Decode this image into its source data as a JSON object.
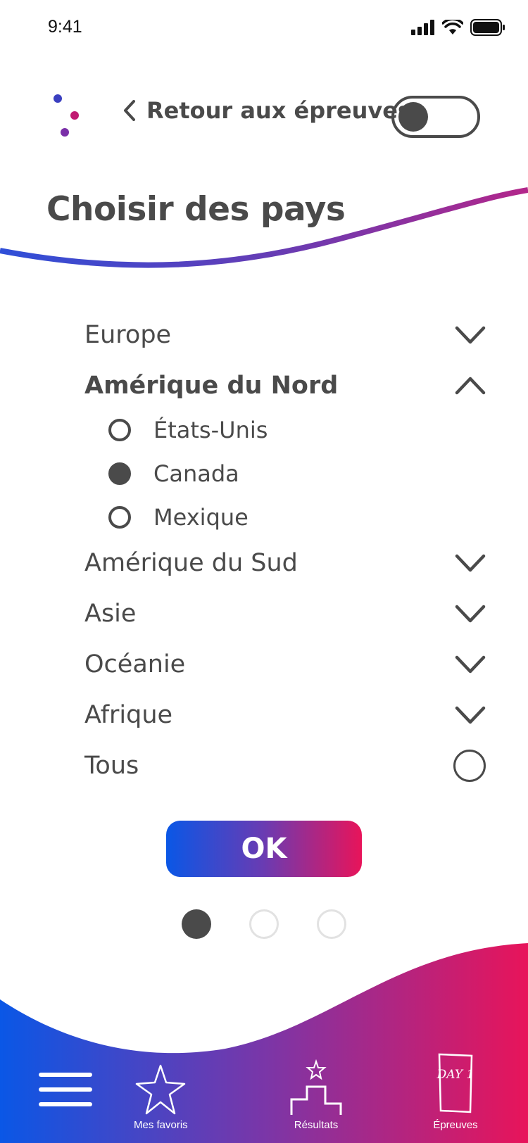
{
  "status_bar": {
    "time": "9:41"
  },
  "header": {
    "back_label": "Retour aux épreuves",
    "title": "Choisir des pays"
  },
  "regions": [
    {
      "label": "Europe",
      "expanded": false
    },
    {
      "label": "Amérique du Nord",
      "expanded": true,
      "countries": [
        {
          "label": "États-Unis",
          "selected": false
        },
        {
          "label": "Canada",
          "selected": true
        },
        {
          "label": "Mexique",
          "selected": false
        }
      ]
    },
    {
      "label": "Amérique du Sud",
      "expanded": false
    },
    {
      "label": "Asie",
      "expanded": false
    },
    {
      "label": "Océanie",
      "expanded": false
    },
    {
      "label": "Afrique",
      "expanded": false
    }
  ],
  "all_option": {
    "label": "Tous",
    "selected": false
  },
  "ok_button": {
    "label": "OK"
  },
  "pagination": {
    "current": 1,
    "total": 3
  },
  "bottom_nav": {
    "favorites_label": "Mes favoris",
    "results_label": "Résultats",
    "events_label": "Épreuves",
    "events_icon_text": "DAY 1"
  },
  "colors": {
    "text": "#4a4a4a",
    "gradient_start": "#0a57e6",
    "gradient_end": "#e8145a"
  }
}
